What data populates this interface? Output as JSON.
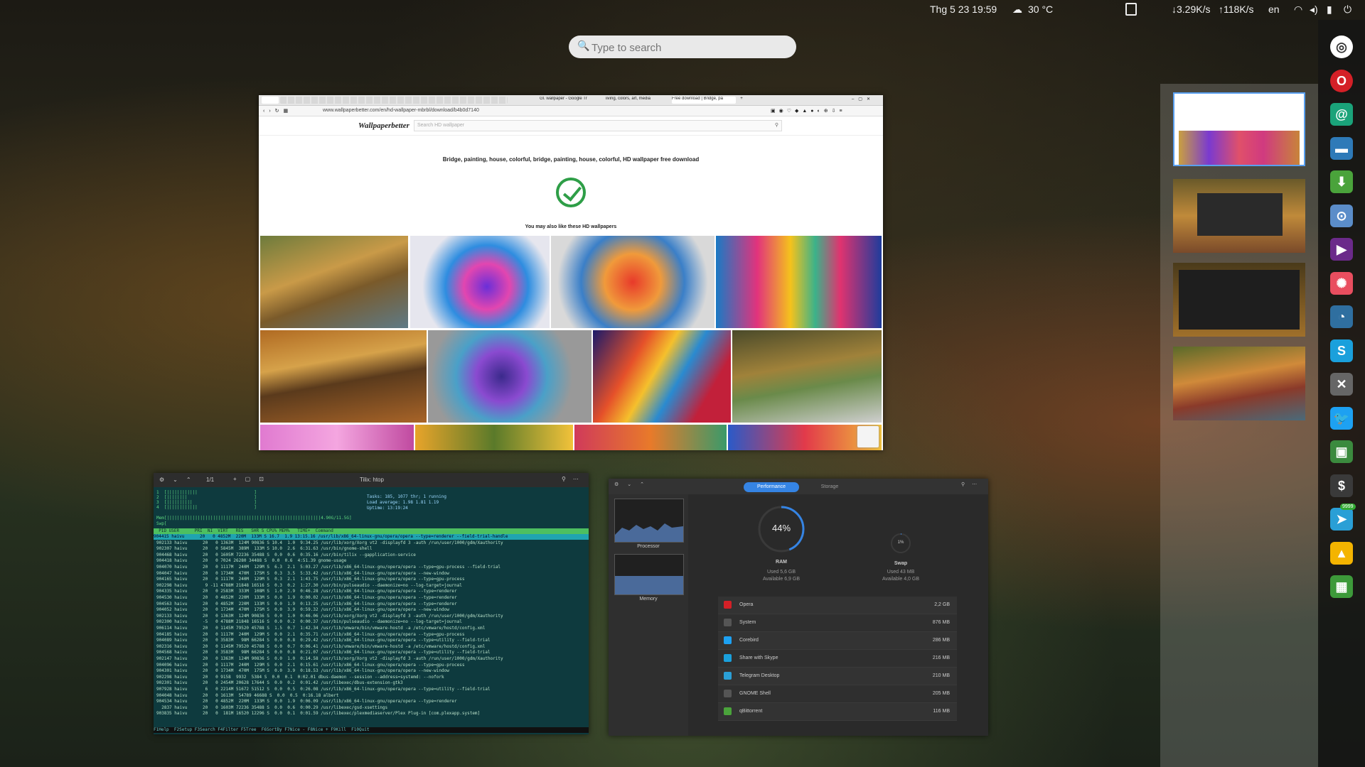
{
  "topbar": {
    "datetime": "Thg 5 23  19:59",
    "weather_temp": "30 °C",
    "net_down": "↓3.29K/s",
    "net_up": "↑118K/s",
    "lang": "en"
  },
  "search": {
    "placeholder": "Type to search"
  },
  "browser": {
    "tabs": [
      "Gl. wallpaper - Google Tr",
      "living, colors, art, media",
      "Free download | Bridge, pa"
    ],
    "url": "www.wallpaperbetter.com/en/hd-wallpaper-mbrbl/download/b4b0d7140",
    "site_logo": "Wallpaperbetter",
    "site_search_placeholder": "Search HD wallpaper",
    "page_title": "Bridge, painting, house, colorful, bridge, painting, house, colorful, HD wallpaper free download",
    "also_like": "You may also like these HD wallpapers"
  },
  "terminal": {
    "title": "Tilix: htop",
    "tab_indicator": "1/1",
    "summary": [
      "Tasks: 185, 1077 thr; 1 running",
      "Load average: 1.98 1.81 1.19",
      "Uptime: 13:19:24"
    ],
    "mem_label": "Mem[",
    "mem_value": "4.90G/11.5G]",
    "swp_label": "Swp[",
    "columns": "  PID USER      PRI  NI  VIRT   RES   SHR S CPU% MEM%   TIME+  Command",
    "rows": [
      "904415 haivu      20   0 4852M  220M  133M S 16.7  1.9 13:15.16 /usr/lib/x86_64-linux-gnu/opera/opera --type=renderer --field-trial-handle",
      "902133 haivu      20   0 1363M  124M 90836 S 10.4  1.0  9:34.25 /usr/lib/xorg/Xorg vt2 -displayfd 3 -auth /run/user/1000/gdm/Xauthority",
      "902307 haivu      20   0 5845M  389M  133M S 10.0  2.6  6:31.63 /usr/bin/gnome-shell",
      "904468 haivu      20   0 1605M 72236 35488 S  0.0  0.6  0:35.16 /usr/bin/tilix --gapplication-service",
      "904418 haivu      20   0 7024 26280 34488 S  0.0  0.6  4:51.39 gnome-usage",
      "904070 haivu      20   0 1117M  240M  129M S  6.3  2.1  5:03.27 /usr/lib/x86_64-linux-gnu/opera/opera --type=gpu-process --field-trial",
      "904047 haivu      20   0 1734M  470M  175M S  0.3  3.5  5:33.42 /usr/lib/x86_64-linux-gnu/opera/opera --new-window",
      "904165 haivu      20   0 1117M  240M  129M S  0.3  2.1  1:43.75 /usr/lib/x86_64-linux-gnu/opera/opera --type=gpu-process",
      "902298 haivu       9 -11 4788M 21848 16516 S  0.3  0.2  1:27.30 /usr/bin/pulseaudio --daemonize=no --log-target=journal",
      "904335 haivu      20   0 2583M  333M  108M S  1.0  2.9  0:46.28 /usr/lib/x86_64-linux-gnu/opera/opera --type=renderer",
      "904530 haivu      20   0 4852M  220M  133M S  0.0  1.9  0:00.02 /usr/lib/x86_64-linux-gnu/opera/opera --type=renderer",
      "904563 haivu      20   0 4852M  220M  133M S  0.0  1.9  0:13.25 /usr/lib/x86_64-linux-gnu/opera/opera --type=renderer",
      "904052 haivu      20   0 1734M  470M  175M S  0.0  3.9  0:59.32 /usr/lib/x86_64-linux-gnu/opera/opera --new-window",
      "902133 haivu      20   0 1363M  124M 90836 S  0.0  1.0  0:46.06 /usr/lib/xorg/Xorg vt2 -displayfd 3 -auth /run/user/1000/gdm/Xauthority",
      "902300 haivu      -5   0 4788M 21848 16516 S  0.0  0.2  0:00.37 /usr/bin/pulseaudio --daemonize=no --log-target=journal",
      "906114 haivu      20   0 1145M 79520 45788 S  1.5  0.7  1:42.34 /usr/lib/vmware/bin/vmware-hostd -a /etc/vmware/hostd/config.xml",
      "904185 haivu      20   0 1117M  240M  129M S  0.0  2.1  0:35.71 /usr/lib/x86_64-linux-gnu/opera/opera --type=gpu-process",
      "904089 haivu      20   0 3583M   98M 66284 S  0.0  0.8  0:29.42 /usr/lib/x86_64-linux-gnu/opera/opera --type=utility --field-trial",
      "902316 haivu      20   0 1145M 79520 45788 S  0.0  0.7  0:06.41 /usr/lib/vmware/bin/vmware-hostd -a /etc/vmware/hostd/config.xml",
      "904568 haivu      20   0 3583M   98M 66284 S  0.0  0.8  0:21.07 /usr/lib/x86_64-linux-gnu/opera/opera --type=utility --field-trial",
      "902147 haivu      20   0 1363M  124M 90836 S  0.0  1.0  0:14.58 /usr/lib/xorg/Xorg vt2 -displayfd 3 -auth /run/user/1000/gdm/Xauthority",
      "904096 haivu      20   0 1117M  240M  129M S  0.0  2.1  0:15.61 /usr/lib/x86_64-linux-gnu/opera/opera --type=gpu-process",
      "904301 haivu      20   0 1734M  470M  175M S  0.0  3.9  0:18.53 /usr/lib/x86_64-linux-gnu/opera/opera --new-window",
      "902298 haivu      20   0 9158  9932  5384 S  0.0  0.1  0:02.01 dbus-daemon --session --address=systemd: --nofork",
      "902301 haivu      20   0 2454M 20628 17644 S  0.0  0.2  0:01.42 /usr/libexec/dbus-extension-gtk3",
      "907928 haivu       6   0 2214M 51672 51512 S  0.0  0.5  0:26.08 /usr/lib/x86_64-linux-gnu/opera/opera --type=utility --field-trial",
      "904048 haivu      20   0 1613M  54789 46688 S  0.0  0.5  0:16.18 albert",
      "904534 haivu      20   0 4852M  220M  133M S  0.0  1.9  0:06.09 /usr/lib/x86_64-linux-gnu/opera/opera --type=renderer",
      "  2837 haivu      20   0 1603M 72236 35488 S  0.0  0.6  0:00.29 /usr/libexec/gsd-xsettings",
      "903835 haivu      20   0  181M 16520 12296 S  0.0  0.1  0:01.59 /usr/libexec/plexmediaserver/Plex Plug-in [com.plexapp.system]"
    ],
    "footer": "F1Help  F2Setup F3Search F4Filter F5Tree  F6SortBy F7Nice - F8Nice + F9Kill  F10Quit"
  },
  "sysmon": {
    "tab_performance": "Performance",
    "tab_storage": "Storage",
    "side_processor": "Processor",
    "side_memory": "Memory",
    "ram_pct": "44%",
    "ram_pct_value": 44,
    "ram_label": "RAM",
    "ram_used": "Used  5,6 GB",
    "ram_avail": "Available  6,9 GB",
    "swap_pct": "1%",
    "swap_pct_value": 1,
    "swap_label": "Swap",
    "swap_used": "Used  43 MB",
    "swap_avail": "Available  4,0 GB",
    "processes": [
      {
        "name": "Opera",
        "size": "2,2 GB",
        "color": "#d42027"
      },
      {
        "name": "System",
        "size": "876 MB",
        "color": "#555555"
      },
      {
        "name": "Corebird",
        "size": "286 MB",
        "color": "#1da1f2"
      },
      {
        "name": "Share with Skype",
        "size": "216 MB",
        "color": "#1aa0dc"
      },
      {
        "name": "Telegram Desktop",
        "size": "210 MB",
        "color": "#2a9fd6"
      },
      {
        "name": "GNOME Shell",
        "size": "205 MB",
        "color": "#555555"
      },
      {
        "name": "qBittorrent",
        "size": "116 MB",
        "color": "#4aa33b"
      }
    ]
  },
  "dock": {
    "icons": [
      {
        "name": "chromium-icon",
        "glyph": "◎",
        "bg": "#ffffff",
        "fg": "#333333"
      },
      {
        "name": "opera-icon",
        "glyph": "O",
        "bg": "#d42027",
        "fg": "#ffffff"
      },
      {
        "name": "mail-icon",
        "glyph": "@",
        "bg": "#1aa37a",
        "fg": "#ffffff"
      },
      {
        "name": "files-icon",
        "glyph": "▬",
        "bg": "#2e7ab8",
        "fg": "#ffffff"
      },
      {
        "name": "download-icon",
        "glyph": "⬇",
        "bg": "#4aa33b",
        "fg": "#ffffff"
      },
      {
        "name": "toggle-icon",
        "glyph": "⊙",
        "bg": "#5b8dc9",
        "fg": "#ffffff"
      },
      {
        "name": "media-player-icon",
        "glyph": "▶",
        "bg": "#6b2a8a",
        "fg": "#ffffff"
      },
      {
        "name": "pinwheel-icon",
        "glyph": "✺",
        "bg": "#e94e5f",
        "fg": "#ffffff"
      },
      {
        "name": "gauge-icon",
        "glyph": "◔",
        "bg": "#2f6fa0",
        "fg": "#ffffff"
      },
      {
        "name": "skype-icon",
        "glyph": "S",
        "bg": "#1aa0dc",
        "fg": "#ffffff"
      },
      {
        "name": "tools-icon",
        "glyph": "✕",
        "bg": "#666666",
        "fg": "#ffffff"
      },
      {
        "name": "twitter-icon",
        "glyph": "🐦",
        "bg": "#1da1f2",
        "fg": "#ffffff"
      },
      {
        "name": "video-icon",
        "glyph": "▣",
        "bg": "#3b8a3e",
        "fg": "#ffffff"
      },
      {
        "name": "money-icon",
        "glyph": "$",
        "bg": "#3a3a3a",
        "fg": "#ffffff"
      },
      {
        "name": "telegram-icon",
        "glyph": "➤",
        "bg": "#2a9fd6",
        "fg": "#ffffff",
        "badge": "9999"
      },
      {
        "name": "drive-icon",
        "glyph": "▲",
        "bg": "#f4b400",
        "fg": "#ffffff"
      },
      {
        "name": "box-icon",
        "glyph": "▦",
        "bg": "#3d9a3a",
        "fg": "#ffffff"
      }
    ]
  }
}
